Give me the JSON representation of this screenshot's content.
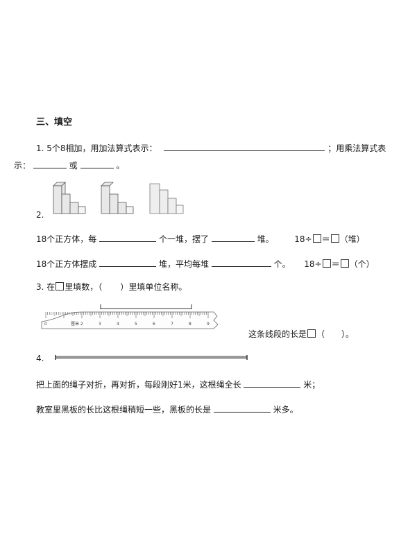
{
  "section": {
    "title": "三、填空"
  },
  "q1": {
    "number": "1.",
    "text_a": "5个8相加，用加法算式表示：",
    "text_b": "；用乘法算式表",
    "text_c": "示：",
    "or_word": "或",
    "period": "。"
  },
  "q2": {
    "number": "2.",
    "line1": {
      "a": "18个正方体，每",
      "b": "个一堆，摆了",
      "c": "堆。",
      "eq_left": "18÷",
      "eq_equals": "＝",
      "eq_unit": "（堆）"
    },
    "line2": {
      "a": "18个正方体摆成",
      "b": "堆，平均每堆",
      "c": "个。",
      "eq_left": "18÷",
      "eq_equals": "＝",
      "eq_unit": "（个）"
    }
  },
  "q3": {
    "number": "3.",
    "text_a": "在",
    "text_b": "里填数，（",
    "text_c": "）里填单位名称。",
    "ruler_labels": [
      "0",
      "厘米 2",
      "3",
      "4",
      "5",
      "6",
      "7",
      "8",
      "9"
    ],
    "answer_a": "这条线段的长是",
    "answer_b": "（",
    "answer_c": "）。"
  },
  "q4": {
    "number": "4.",
    "line1_a": "把上面的绳子对折，再对折，每段刚好1米，这根绳全长",
    "line1_b": "米；",
    "line2_a": "教室里黑板的长比这根绳稍短一些，黑板的长是",
    "line2_b": "米多。"
  }
}
